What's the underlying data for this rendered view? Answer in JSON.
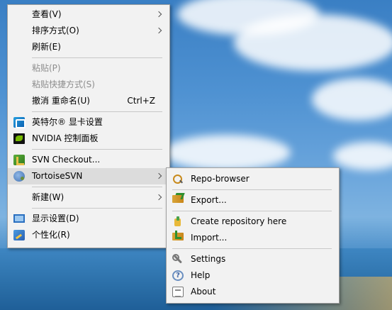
{
  "context_menu": {
    "items": [
      {
        "label": "查看(V)",
        "icon": "",
        "submenu": true
      },
      {
        "label": "排序方式(O)",
        "icon": "",
        "submenu": true
      },
      {
        "label": "刷新(E)",
        "icon": ""
      },
      {
        "separator": true
      },
      {
        "label": "粘贴(P)",
        "disabled": true
      },
      {
        "label": "粘贴快捷方式(S)",
        "disabled": true
      },
      {
        "label": "撤消 重命名(U)",
        "shortcut": "Ctrl+Z"
      },
      {
        "separator": true
      },
      {
        "label": "英特尔® 显卡设置",
        "icon": "intel-graphics-icon"
      },
      {
        "label": "NVIDIA 控制面板",
        "icon": "nvidia-icon"
      },
      {
        "separator": true
      },
      {
        "label": "SVN Checkout...",
        "icon": "svn-checkout-icon"
      },
      {
        "label": "TortoiseSVN",
        "icon": "tortoisesvn-icon",
        "submenu": true,
        "highlighted": true
      },
      {
        "separator": true
      },
      {
        "label": "新建(W)",
        "submenu": true
      },
      {
        "separator": true
      },
      {
        "label": "显示设置(D)",
        "icon": "display-settings-icon"
      },
      {
        "label": "个性化(R)",
        "icon": "personalize-icon"
      }
    ]
  },
  "tortoise_submenu": {
    "items": [
      {
        "label": "Repo-browser",
        "icon": "repo-browser-icon"
      },
      {
        "separator": true
      },
      {
        "label": "Export...",
        "icon": "export-icon"
      },
      {
        "separator": true
      },
      {
        "label": "Create repository here",
        "icon": "create-repository-icon"
      },
      {
        "label": "Import...",
        "icon": "import-icon"
      },
      {
        "separator": true
      },
      {
        "label": "Settings",
        "icon": "settings-icon"
      },
      {
        "label": "Help",
        "icon": "help-icon",
        "glyph": "?"
      },
      {
        "label": "About",
        "icon": "about-icon"
      }
    ]
  }
}
